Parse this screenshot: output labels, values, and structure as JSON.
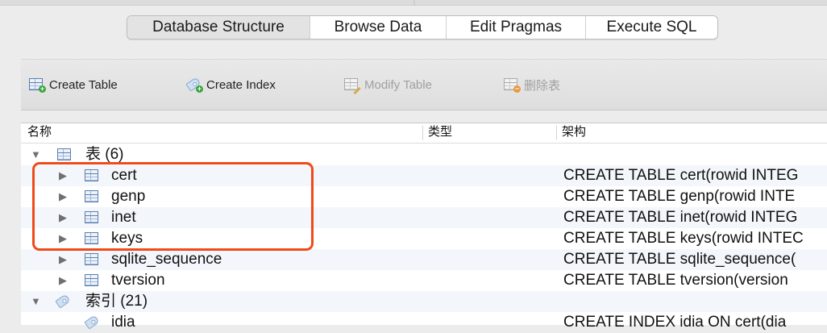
{
  "tabs": [
    {
      "label": "Database Structure",
      "active": true
    },
    {
      "label": "Browse Data",
      "active": false
    },
    {
      "label": "Edit Pragmas",
      "active": false
    },
    {
      "label": "Execute SQL",
      "active": false
    }
  ],
  "toolbar": {
    "create_table": {
      "label": "Create Table",
      "icon": "table-add-icon",
      "enabled": true
    },
    "create_index": {
      "label": "Create Index",
      "icon": "index-add-icon",
      "enabled": true
    },
    "modify_table": {
      "label": "Modify Table",
      "icon": "table-edit-icon",
      "enabled": false
    },
    "delete_table": {
      "label": "删除表",
      "icon": "table-delete-icon",
      "enabled": false
    }
  },
  "columns": {
    "name": "名称",
    "type": "类型",
    "schema": "架构"
  },
  "tree": {
    "tables_group": {
      "label": "表 (6)",
      "expanded": true
    },
    "tables": [
      {
        "name": "cert",
        "schema": "CREATE TABLE cert(rowid INTEG"
      },
      {
        "name": "genp",
        "schema": "CREATE TABLE genp(rowid INTE"
      },
      {
        "name": "inet",
        "schema": "CREATE TABLE inet(rowid INTEG"
      },
      {
        "name": "keys",
        "schema": "CREATE TABLE keys(rowid INTEC"
      },
      {
        "name": "sqlite_sequence",
        "schema": "CREATE TABLE sqlite_sequence("
      },
      {
        "name": "tversion",
        "schema": "CREATE TABLE tversion(version"
      }
    ],
    "indices_group": {
      "label": "索引 (21)",
      "expanded": true
    },
    "partial_row": {
      "name": "idia",
      "schema": "CREATE INDEX idia ON cert(dia"
    }
  },
  "colors": {
    "highlight": "#f04a1a",
    "alt_row": "#f3f6fb",
    "table_icon": "#5b7fb0"
  }
}
